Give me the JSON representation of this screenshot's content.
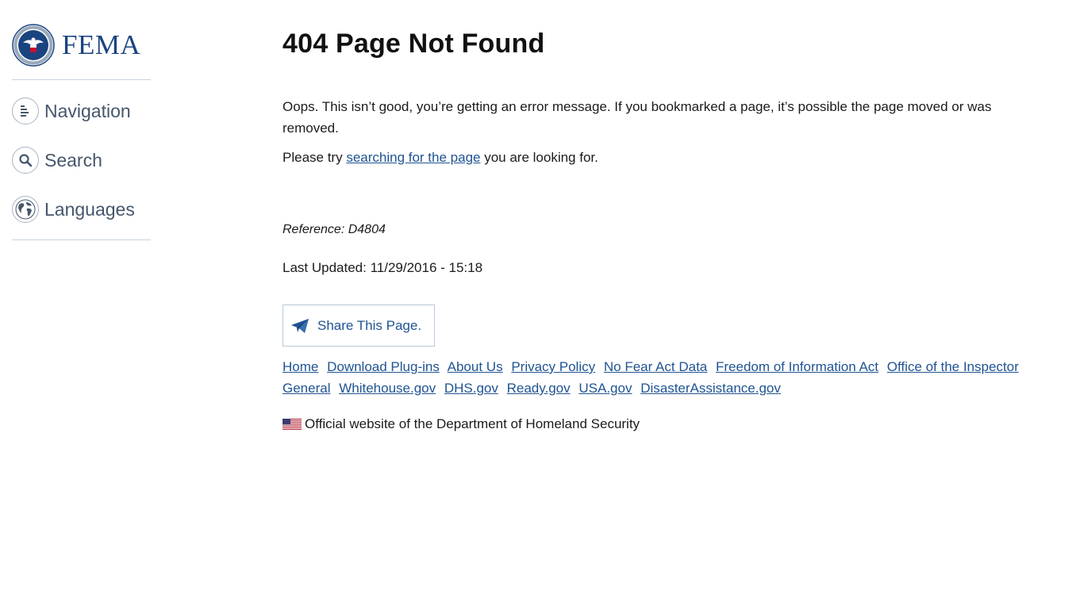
{
  "logo": {
    "text": "FEMA"
  },
  "sidebar": {
    "items": [
      {
        "label": "Navigation",
        "icon": "navigation-menu-icon"
      },
      {
        "label": "Search",
        "icon": "search-icon"
      },
      {
        "label": "Languages",
        "icon": "globe-icon"
      }
    ]
  },
  "main": {
    "title": "404 Page Not Found",
    "paragraph1": "Oops. This isn’t good, you’re getting an error message. If you bookmarked a page, it’s possible the page moved or was removed.",
    "paragraph2_before": "Please try ",
    "paragraph2_link": "searching for the page",
    "paragraph2_after": " you are looking for.",
    "reference": "Reference: D4804",
    "last_updated": "Last Updated: 11/29/2016 - 15:18",
    "share_label": "Share This Page."
  },
  "footer": {
    "links": [
      "Home",
      "Download Plug-ins",
      "About Us",
      "Privacy Policy",
      "No Fear Act Data",
      "Freedom of Information Act",
      "Office of the Inspector General",
      "Whitehouse.gov",
      "DHS.gov",
      "Ready.gov",
      "USA.gov",
      "DisasterAssistance.gov"
    ],
    "official_text": "Official website of the Department of Homeland Security"
  },
  "colors": {
    "link": "#205493",
    "brand": "#1a4480",
    "nav_text": "#46566b"
  }
}
